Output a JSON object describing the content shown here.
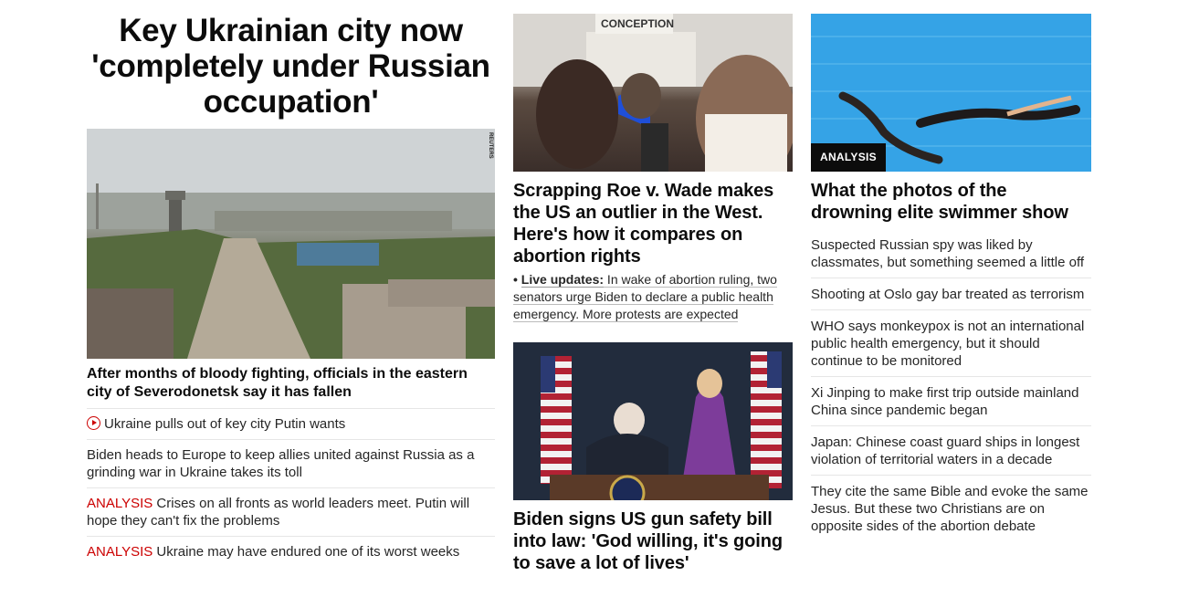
{
  "main": {
    "headline": "Key Ukrainian city now 'completely under Russian occupation'",
    "image_credit": "REUTERS",
    "lead": "After months of bloody fighting, officials in the eastern city of Severodonetsk say it has fallen",
    "links": [
      {
        "prefix": "",
        "text": "Ukraine pulls out of key city Putin wants",
        "icon": "play-circle-icon"
      },
      {
        "prefix": "",
        "text": "Biden heads to Europe to keep allies united against Russia as a grinding war in Ukraine takes its toll"
      },
      {
        "prefix": "ANALYSIS",
        "text": " Crises on all fronts as world leaders meet. Putin will hope they can't fix the problems"
      },
      {
        "prefix": "ANALYSIS",
        "text": " Ukraine may have endured one of its worst weeks"
      }
    ]
  },
  "roe": {
    "sign_text": "CONCEPTION",
    "title": "Scrapping Roe v. Wade makes the US an outlier in the West. Here's how it compares on abortion rights",
    "live_label": "Live updates:",
    "live_text": " In wake of abortion ruling, two senators urge Biden to declare a public health emergency. More protests are expected"
  },
  "biden": {
    "title": "Biden signs US gun safety bill into law: 'God willing, it's going to save a lot of lives'"
  },
  "swimmer": {
    "badge": "ANALYSIS",
    "title": "What the photos of the drowning elite swimmer show",
    "links": [
      "Suspected Russian spy was liked by classmates, but something seemed a little off",
      "Shooting at Oslo gay bar treated as terrorism",
      "WHO says monkeypox is not an international public health emergency, but it should continue to be monitored",
      "Xi Jinping to make first trip outside mainland China since pandemic began",
      "Japan: Chinese coast guard ships in longest violation of territorial waters in a decade",
      "They cite the same Bible and evoke the same Jesus. But these two Christians are on opposite sides of the abortion debate"
    ]
  },
  "colors": {
    "accent_red": "#cc0000",
    "text": "#0c0c0c",
    "divider": "#e6e6e6"
  }
}
